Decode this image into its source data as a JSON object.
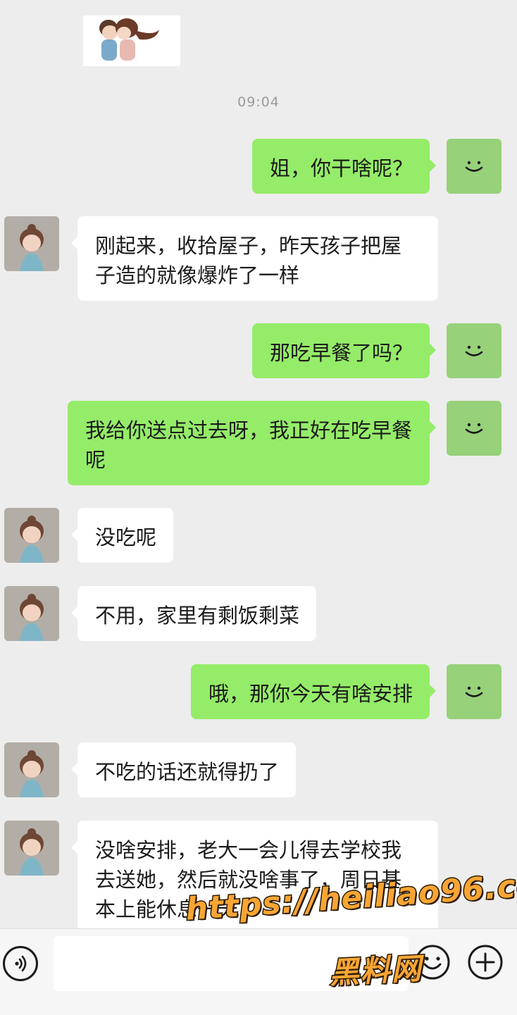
{
  "chat": {
    "timestamp": "09:04",
    "messages": [
      {
        "side": "right",
        "text": "姐，你干啥呢？"
      },
      {
        "side": "left",
        "text": "刚起来，收拾屋子，昨天孩子把屋子造的就像爆炸了一样"
      },
      {
        "side": "right",
        "text": "那吃早餐了吗？"
      },
      {
        "side": "right",
        "text": "我给你送点过去呀，我正好在吃早餐呢"
      },
      {
        "side": "left",
        "text": "没吃呢"
      },
      {
        "side": "left",
        "text": "不用，家里有剩饭剩菜"
      },
      {
        "side": "right",
        "text": "哦，那你今天有啥安排"
      },
      {
        "side": "left",
        "text": "不吃的话还就得扔了"
      },
      {
        "side": "left",
        "text": "没啥安排，老大一会儿得去学校我去送她，然后就没啥事了，周日基本上能休息一天"
      }
    ]
  },
  "input_bar": {
    "voice_icon": "voice-icon",
    "emoji_icon": "emoji-icon",
    "plus_icon": "plus-icon",
    "text_value": ""
  },
  "watermark": {
    "url": "https://heiliao96.com",
    "site": "黑料网"
  },
  "colors": {
    "background": "#ededed",
    "sent_bubble": "#95ec69",
    "received_bubble": "#ffffff",
    "watermark": "#f7a533"
  }
}
